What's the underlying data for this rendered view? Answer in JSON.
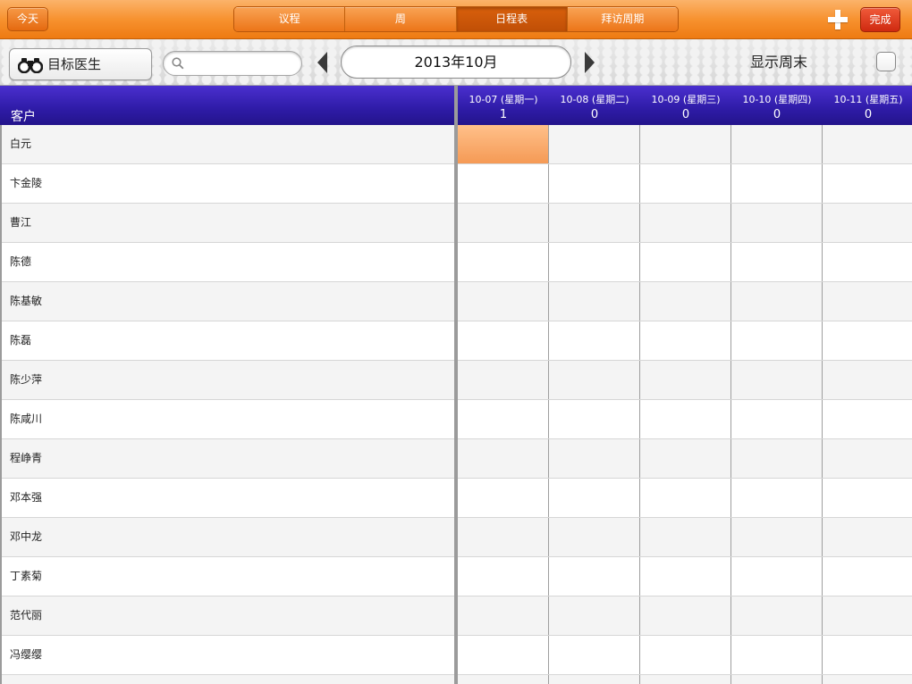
{
  "topbar": {
    "today_label": "今天",
    "segments": [
      {
        "label": "议程",
        "active": false
      },
      {
        "label": "周",
        "active": false
      },
      {
        "label": "日程表",
        "active": true
      },
      {
        "label": "拜访周期",
        "active": false
      }
    ],
    "add_icon": "plus-icon",
    "done_label": "完成"
  },
  "toolbar": {
    "target_label": "目标医生",
    "target_icon": "binoculars-icon",
    "search": {
      "value": "",
      "placeholder": ""
    },
    "month_label": "2013年10月",
    "weekend_label": "显示周末",
    "weekend_checked": false
  },
  "table": {
    "client_header": "客户",
    "days": [
      {
        "date": "10-07 (星期一)",
        "count": "1"
      },
      {
        "date": "10-08 (星期二)",
        "count": "0"
      },
      {
        "date": "10-09 (星期三)",
        "count": "0"
      },
      {
        "date": "10-10 (星期四)",
        "count": "0"
      },
      {
        "date": "10-11 (星期五)",
        "count": "0"
      }
    ],
    "clients": [
      "白元",
      "卞金陵",
      "曹江",
      "陈德",
      "陈基敏",
      "陈磊",
      "陈少萍",
      "陈咸川",
      "程峥青",
      "邓本强",
      "邓中龙",
      "丁素菊",
      "范代丽",
      "冯缨缨"
    ],
    "highlighted_cell": {
      "row": 0,
      "day": 0
    }
  },
  "colors": {
    "orange_bar": "#f7922f",
    "header_purple": "#2e1ba6",
    "highlight": "#f59a55",
    "row_alt": "#f4f4f4"
  }
}
